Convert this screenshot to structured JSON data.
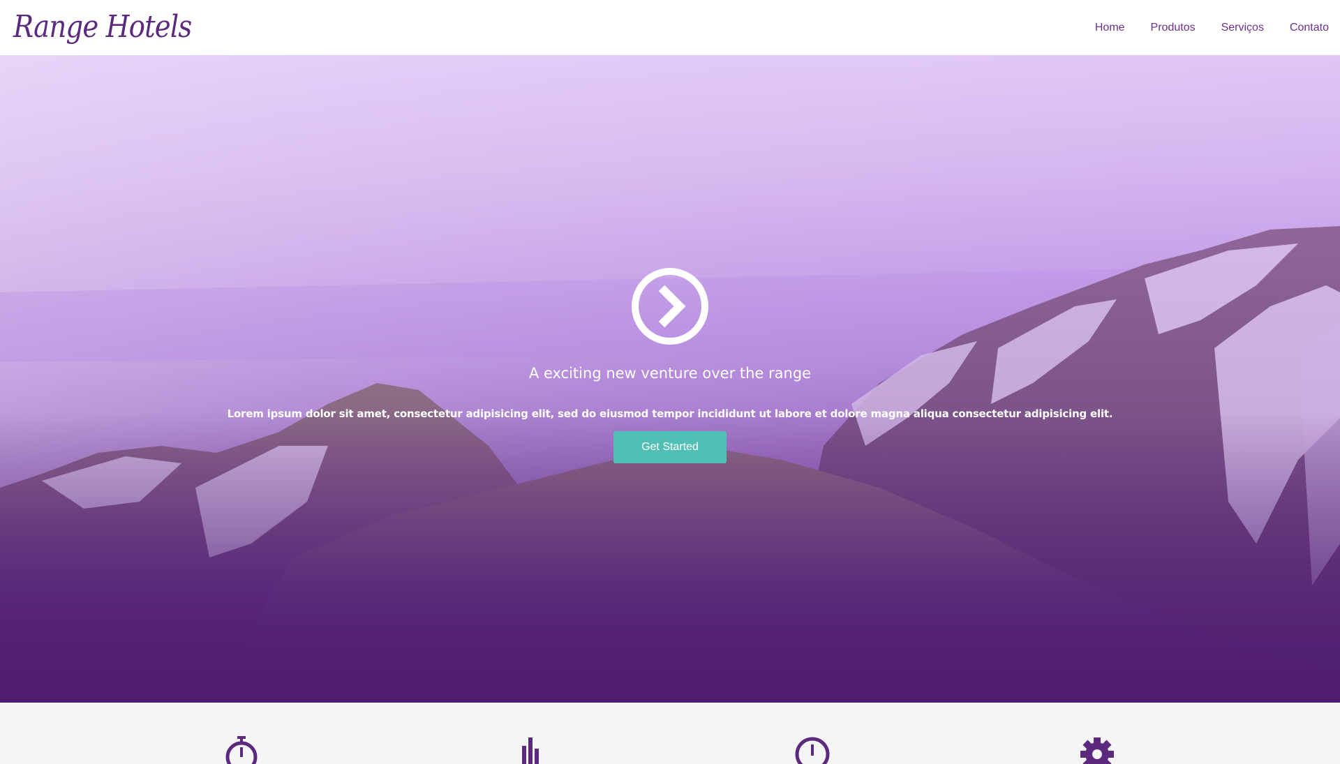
{
  "brand": {
    "name": "Range Hotels",
    "color": "#5b2a7e"
  },
  "nav": {
    "items": [
      {
        "label": "Home"
      },
      {
        "label": "Produtos"
      },
      {
        "label": "Serviços"
      },
      {
        "label": "Contato"
      }
    ]
  },
  "hero": {
    "icon": "chevron-right-circle-icon",
    "title": "A exciting new venture over the range",
    "text": "Lorem ipsum dolor sit amet, consectetur adipisicing elit, sed do eiusmod tempor incididunt ut labore et dolore magna aliqua consectetur adipisicing elit.",
    "cta_label": "Get Started",
    "cta_color": "#52bfb6",
    "overlay_color": "#4e1d70"
  },
  "features": {
    "icons": [
      "stopwatch-icon",
      "bar-chart-icon",
      "clock-icon",
      "gear-icon"
    ]
  }
}
